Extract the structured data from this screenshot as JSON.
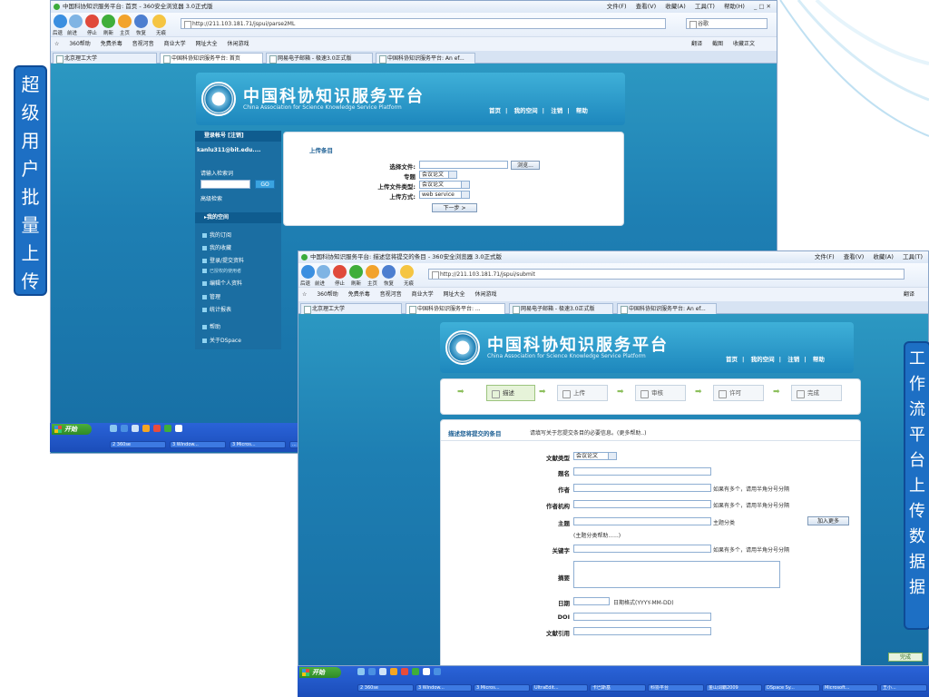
{
  "side_labels": {
    "left": "超级用户批量上传",
    "right": "工作流平台上传数据据"
  },
  "back_window": {
    "title": "中国科协知识服务平台: 首页 - 360安全浏览器 3.0正式版",
    "menus": [
      "文件(F)",
      "查看(V)",
      "收藏(A)",
      "工具(T)",
      "帮助(H)"
    ],
    "window_controls": "_ □ ✕",
    "nav_labels": [
      "后退",
      "前进",
      "停止",
      "刷新",
      "主页",
      "恢复",
      "无痕"
    ],
    "address": "http://211.103.181.71/jspui/parse2ML",
    "search_engine": "谷歌",
    "favorites": [
      "☆",
      "360帮助",
      "免费杀毒",
      "音视河音",
      "商业大学",
      "网址大全",
      "休闲游戏"
    ],
    "toolbar_right": [
      "翻译",
      "截图",
      "收藏正文"
    ],
    "tabs": [
      "北京理工大学",
      "中国科协知识服务平台: 首页",
      "网易电子邮箱 - 极速3.0正式版",
      "中国科协知识服务平台: An ef..."
    ],
    "banner_title": "中国科协知识服务平台",
    "banner_sub": "China Association for Science Knowledge Service Platform",
    "banner_nav": [
      "首页",
      "我的空间",
      "注销",
      "帮助"
    ],
    "sidebar": {
      "account_head": "登录帐号 [注销]",
      "account_user": "kanlu311@bit.edu....",
      "search_label": "请输入检索词",
      "go": "GO",
      "advanced": "高级检索",
      "my_space": "▸我的空间",
      "items": [
        "我的订阅",
        "我的收藏",
        "登录/提交资料",
        "已授权的使用者",
        "编辑个人资料",
        "管理",
        "统计报表",
        "帮助",
        "关于DSpace"
      ]
    },
    "upload": {
      "heading": "上传条目",
      "fields": [
        {
          "label": "选择文件:",
          "value": "",
          "button": "浏览..."
        },
        {
          "label": "专题",
          "value": "会议论文"
        },
        {
          "label": "上传文件类型:",
          "value": "会议论文"
        },
        {
          "label": "上传方式:",
          "value": "web service"
        }
      ],
      "next": "下一步 >"
    }
  },
  "front_window": {
    "title": "中国科协知识服务平台: 描述您将提交的条目 - 360安全浏览器 3.0正式版",
    "menus": [
      "文件(F)",
      "查看(V)",
      "收藏(A)",
      "工具(T)"
    ],
    "nav_labels": [
      "后退",
      "前进",
      "停止",
      "刷新",
      "主页",
      "恢复",
      "无痕"
    ],
    "address": "http://211.103.181.71/jspui/submit",
    "favorites": [
      "☆",
      "360帮助",
      "免费杀毒",
      "音视河音",
      "商业大学",
      "网址大全",
      "休闲游戏"
    ],
    "toolbar_right": [
      "翻译"
    ],
    "tabs": [
      "北京理工大学",
      "中国科协知识服务平台: ...",
      "网易电子邮箱 - 极速3.0正式版",
      "中国科协知识服务平台: An ef..."
    ],
    "banner_title": "中国科协知识服务平台",
    "banner_sub": "China Association for Science Knowledge Service Platform",
    "banner_nav": [
      "首页",
      "我的空间",
      "注销",
      "帮助"
    ],
    "steps": [
      "描述",
      "上传",
      "审核",
      "许可",
      "完成"
    ],
    "desc": {
      "heading": "描述您将提交的条目",
      "subtitle": "请填写关于您提交条目的必要信息。(更多帮助..)",
      "doc_type_label": "文献类型",
      "doc_type_value": "会议论文",
      "title_label": "题名",
      "author_label": "作者",
      "author_hint": "如果有多个，请用半角分号分隔",
      "org_label": "作者机构",
      "org_hint": "如果有多个，请用半角分号分隔",
      "subject_label": "主题",
      "subject_hint": "主题分类",
      "add_more": "加入更多",
      "subject_help": "(主题分类帮助......)",
      "keyword_label": "关键字",
      "keyword_hint": "如果有多个，请用半角分号分隔",
      "abstract_label": "摘要",
      "date_label": "日期",
      "date_hint": "日期格式(YYYY-MM-DD)",
      "doi_label": "DOI",
      "cut_label": "文献引用"
    }
  },
  "status": {
    "done": "完成"
  },
  "taskbar_back": {
    "start": "开始",
    "buttons": [
      "2 360se",
      "3 Window...",
      "3 Micros...",
      "..."
    ]
  },
  "taskbar_front": {
    "start": "开始",
    "buttons": [
      "2 360se",
      "3 Window...",
      "3 Micros...",
      "UltraEdit...",
      "卡巴斯基",
      "科协平台",
      "金山词霸2009",
      "DSpace Sy...",
      "Microsoft...",
      "王小..."
    ]
  }
}
